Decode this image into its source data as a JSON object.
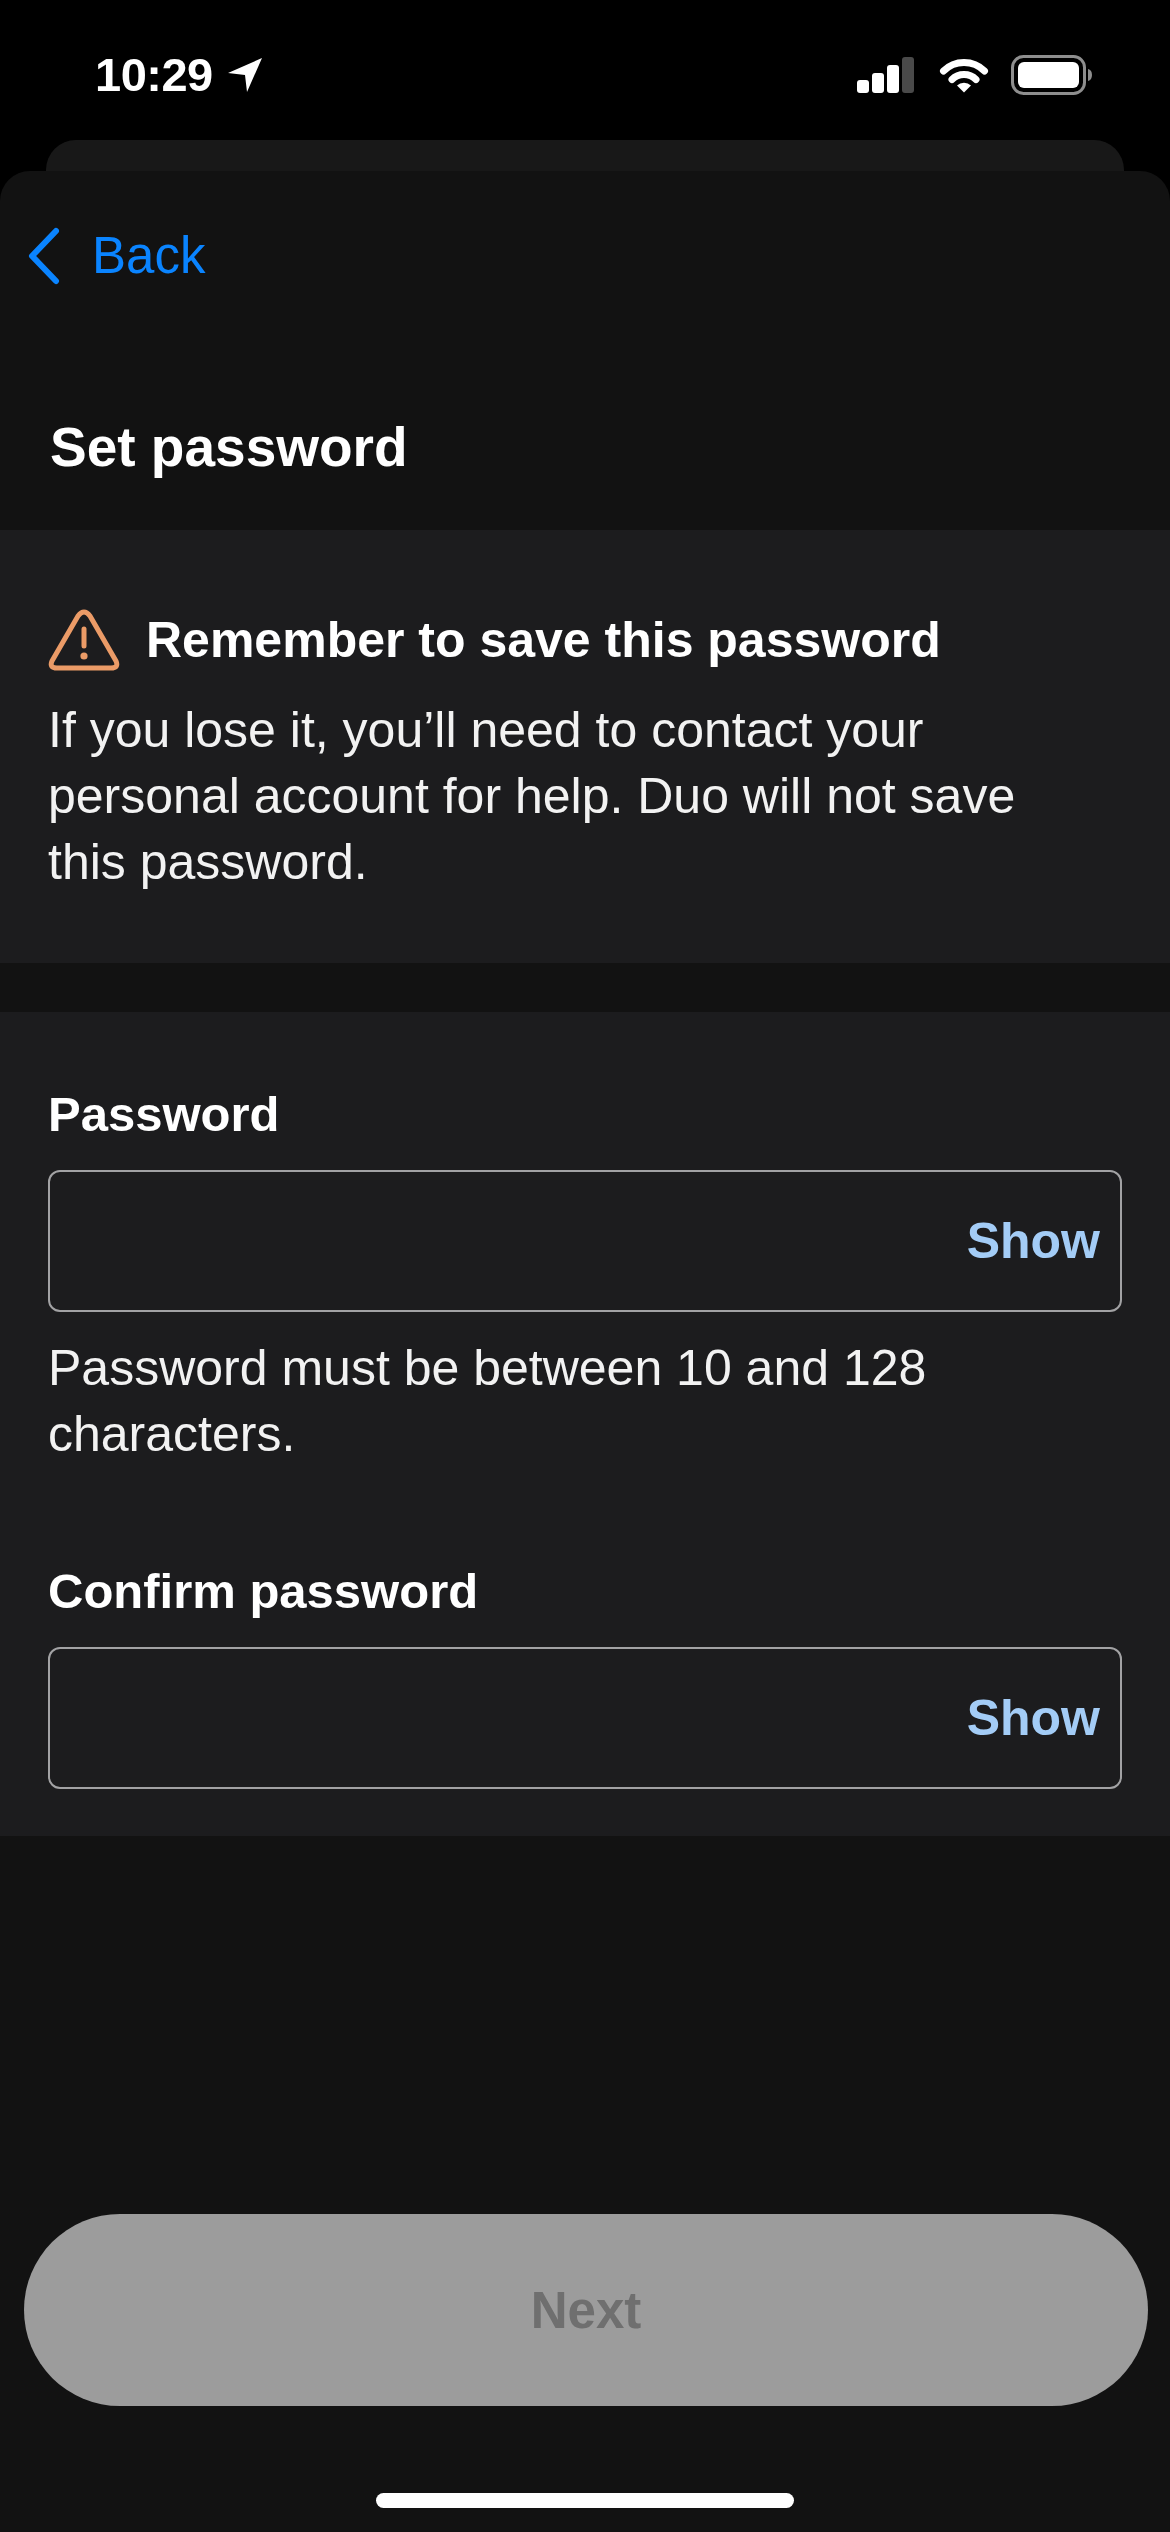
{
  "status_bar": {
    "time": "10:29"
  },
  "nav": {
    "back_label": "Back",
    "title": "Set password"
  },
  "notice": {
    "title": "Remember to save this password",
    "body": "If you lose it, you’ll need to contact your personal account for help. Duo will not save this password."
  },
  "fields": [
    {
      "label": "Password",
      "toggle": "Show",
      "hint": "Password must be between 10 and 128 characters."
    },
    {
      "label": "Confirm password",
      "toggle": "Show"
    }
  ],
  "next_button": {
    "label": "Next",
    "disabled": true
  }
}
